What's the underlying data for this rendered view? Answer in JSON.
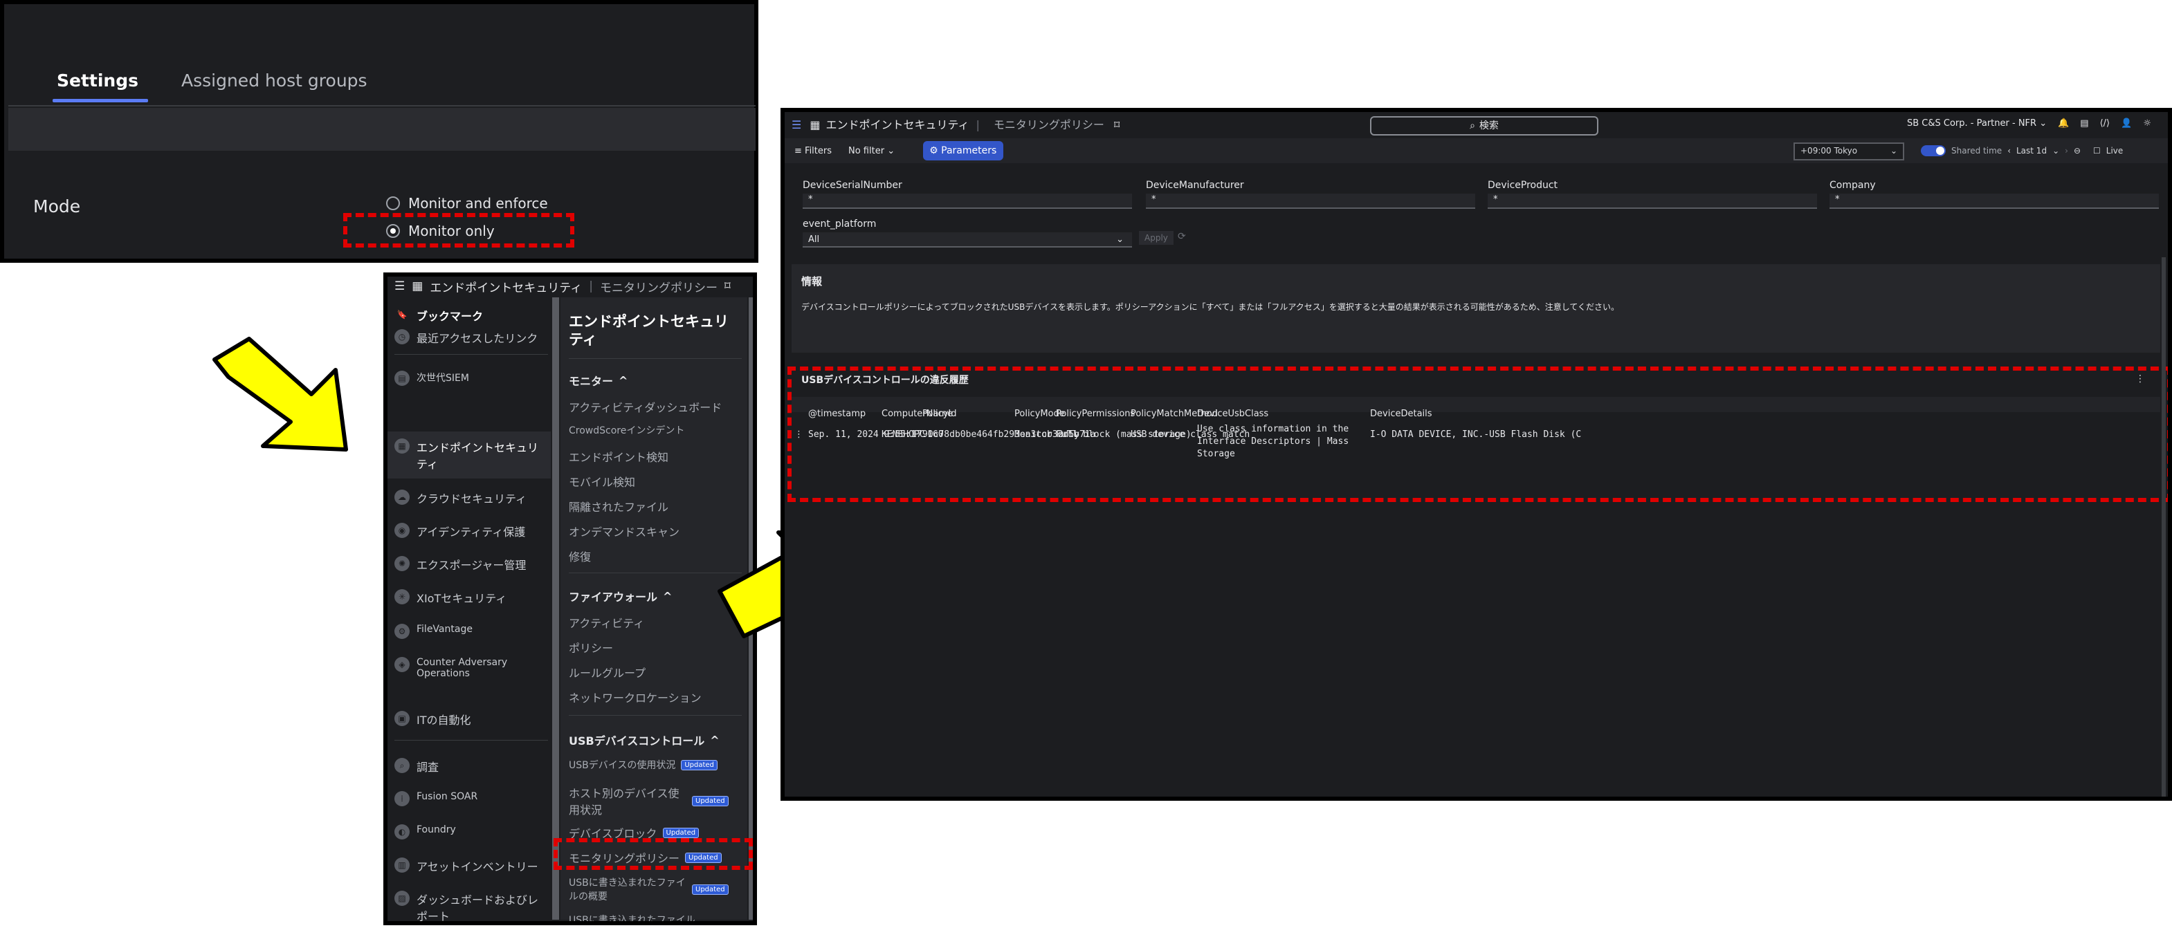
{
  "settings_panel": {
    "tabs": [
      {
        "label": "Settings"
      },
      {
        "label": "Assigned host groups"
      }
    ],
    "mode_label": "Mode",
    "options": [
      {
        "label": "Monitor and enforce",
        "selected": false
      },
      {
        "label": "Monitor only",
        "selected": true
      }
    ]
  },
  "nav_panel": {
    "header_title": "エンドポイントセキュリティ",
    "header_sub": "モニタリングポリシー",
    "left_items": [
      {
        "label": "ブックマーク",
        "icon": "bookmark-icon"
      },
      {
        "label": "最近アクセスしたリンク",
        "icon": "clock-icon"
      },
      {
        "label": "次世代SIEM",
        "icon": "siem-icon"
      },
      {
        "label": "エンドポイントセキュリティ",
        "icon": "endpoint-icon"
      },
      {
        "label": "クラウドセキュリティ",
        "icon": "cloud-icon"
      },
      {
        "label": "アイデンティティ保護",
        "icon": "identity-icon"
      },
      {
        "label": "エクスポージャー管理",
        "icon": "exposure-icon"
      },
      {
        "label": "XIoTセキュリティ",
        "icon": "xiot-icon"
      },
      {
        "label": "FileVantage",
        "icon": "filevantage-icon"
      },
      {
        "label": "Counter Adversary Operations",
        "icon": "counter-adversary-icon"
      },
      {
        "label": "ITの自動化",
        "icon": "it-automation-icon"
      },
      {
        "label": "調査",
        "icon": "investigate-icon"
      },
      {
        "label": "Fusion SOAR",
        "icon": "fusion-soar-icon"
      },
      {
        "label": "Foundry",
        "icon": "foundry-icon"
      },
      {
        "label": "アセットインベントリー",
        "icon": "asset-icon"
      },
      {
        "label": "ダッシュボードおよびレポート",
        "icon": "dashboard-icon"
      }
    ],
    "right_title": "エンドポイントセキュリティ",
    "sections": [
      {
        "head": "モニター",
        "items": [
          "アクティビティダッシュボード",
          "CrowdScoreインシデント",
          "エンドポイント検知",
          "モバイル検知",
          "隔離されたファイル",
          "オンデマンドスキャン",
          "修復"
        ]
      },
      {
        "head": "ファイアウォール",
        "items": [
          "アクティビティ",
          "ポリシー",
          "ルールグループ",
          "ネットワークロケーション"
        ]
      },
      {
        "head": "USBデバイスコントロール",
        "items": [
          "USBデバイスの使用状況",
          "ホスト別のデバイス使用状況",
          "デバイスブロック",
          "モニタリングポリシー",
          "USBに書き込まれたファイルの概要",
          "USBに書き込まれたファイル"
        ]
      }
    ],
    "badge": "Updated"
  },
  "main_window": {
    "title": "エンドポイントセキュリティ",
    "subtitle": "モニタリングポリシー",
    "search_label": "検索",
    "account": "SB C&S Corp. - Partner - NFR",
    "filters_label": "Filters",
    "no_filter_label": "No filter",
    "parameters_label": "Parameters",
    "timezone": "+09:00 Tokyo",
    "shared_time": "Shared time",
    "range": "Last 1d",
    "live": "Live",
    "params": [
      {
        "label": "DeviceSerialNumber",
        "value": "*"
      },
      {
        "label": "DeviceManufacturer",
        "value": "*"
      },
      {
        "label": "DeviceProduct",
        "value": "*"
      },
      {
        "label": "Company",
        "value": "*"
      }
    ],
    "event_platform_label": "event_platform",
    "event_platform_value": "All",
    "apply_label": "Apply",
    "info_title": "情報",
    "info_text": "デバイスコントロールポリシーによってブロックされたUSBデバイスを表示します。ポリシーアクションに「すべて」または「フルアクセス」を選択すると大量の結果が表示される可能性があるため、注意してください。",
    "table_title": "USBデバイスコントロールの違反履歴",
    "columns": [
      "@timestamp",
      "ComputerName",
      "PolicyId",
      "PolicyMode",
      "PolicyPermissions",
      "PolicyMatchMethod",
      "DeviceUsbClass",
      "DeviceDetails"
    ],
    "row": {
      "timestamp": "Sep. 11, 2024 9:55:17.160",
      "computer": "KENSHOPC",
      "policy_id": "90c78db0be464fb293ea3ccb32d5b71a",
      "mode": "Monitor only",
      "permissions": "Full block (mass storage)",
      "match": "USB device class match",
      "usb_class": "Use class information in the Interface Descriptors | Mass Storage",
      "details": "I-O DATA DEVICE, INC.-USB Flash Disk (C"
    }
  },
  "colors": {
    "accent": "#3356c9",
    "highlight": "#e00000",
    "arrow": "#ffff00"
  }
}
